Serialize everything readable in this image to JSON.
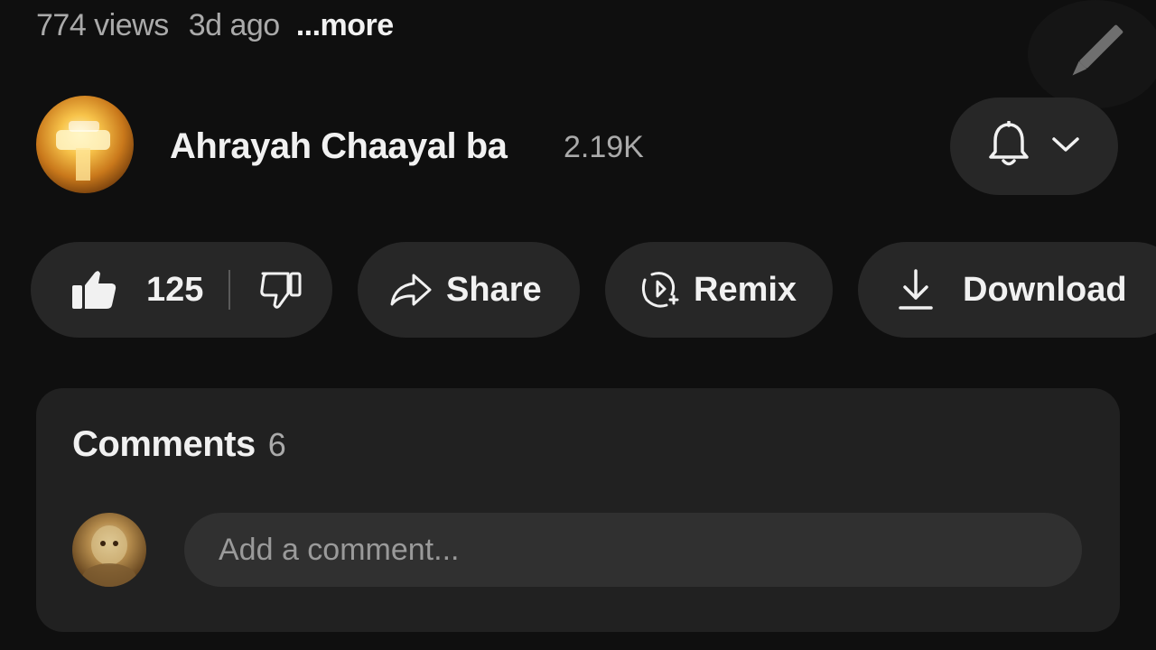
{
  "meta": {
    "views": "774 views",
    "age": "3d ago",
    "more_label": "...more"
  },
  "channel": {
    "name": "Ahrayah Chaayal ba",
    "subscribers": "2.19K"
  },
  "actions": {
    "like_count": "125",
    "share_label": "Share",
    "remix_label": "Remix",
    "download_label": "Download"
  },
  "comments": {
    "title": "Comments",
    "count": "6",
    "input_placeholder": "Add a comment..."
  },
  "icons": {
    "edit": "pencil-icon",
    "bell": "bell-icon",
    "chevron": "chevron-down-icon",
    "like": "thumbs-up-icon",
    "dislike": "thumbs-down-icon",
    "share": "share-arrow-icon",
    "remix": "remix-icon",
    "download": "download-icon"
  },
  "colors": {
    "background": "#0f0f0f",
    "pill": "#272727",
    "card": "#212121",
    "text_primary": "#f1f1f1",
    "text_secondary": "#aaaaaa"
  }
}
